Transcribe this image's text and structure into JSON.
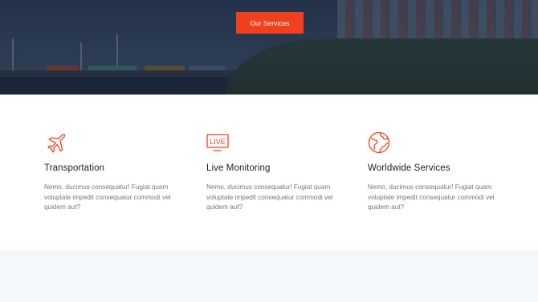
{
  "hero": {
    "cta_label": "Our Services"
  },
  "features": [
    {
      "icon": "airplane-icon",
      "title": "Transportation",
      "desc": "Nemo, ducimus consequatur! Fugiat quam voluptate impedit consequatur commodi vel quidem aut?"
    },
    {
      "icon": "live-icon",
      "icon_text": "LIVE",
      "title": "Live Monitoring",
      "desc": "Nemo, ducimus consequatur! Fugiat quam voluptate impedit consequatur commodi vel quidem aut?"
    },
    {
      "icon": "globe-icon",
      "title": "Worldwide Services",
      "desc": "Nemo, ducimus consequatur! Fugiat quam voluptate impedit consequatur commodi vel quidem aut?"
    }
  ],
  "colors": {
    "accent": "#f0411f",
    "title": "#222222",
    "body_text": "#777777",
    "section_bg": "#f4f8fc"
  }
}
